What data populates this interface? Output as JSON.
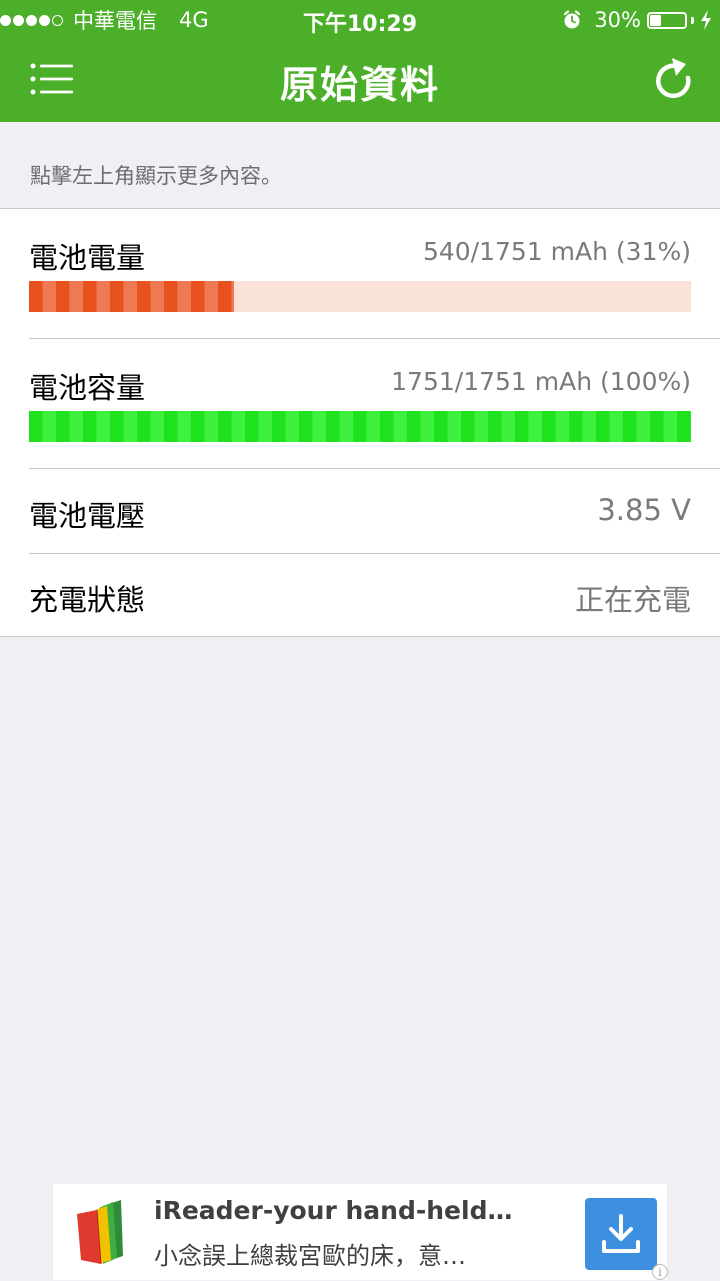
{
  "status_bar": {
    "carrier": "中華電信",
    "network": "4G",
    "time": "下午10:29",
    "battery_percent_text": "30%",
    "battery_level": 0.3,
    "icons": [
      "signal-dots-icon",
      "alarm-icon",
      "battery-icon",
      "charging-bolt-icon"
    ]
  },
  "nav": {
    "title": "原始資料",
    "left_icon": "menu-icon",
    "right_icon": "refresh-icon"
  },
  "hint": "點擊左上角顯示更多內容。",
  "rows": [
    {
      "label": "電池電量",
      "value": "540/1751 mAh (31%)",
      "fill": 0.31,
      "color": "#e8521f"
    },
    {
      "label": "電池容量",
      "value": "1751/1751 mAh (100%)",
      "fill": 1.0,
      "color": "#1de21d"
    },
    {
      "label": "電池電壓",
      "value": "3.85 V"
    },
    {
      "label": "充電狀態",
      "value": "正在充電"
    }
  ],
  "ad": {
    "title": "iReader-your hand-held…",
    "subtitle": "小念誤上總裁宮歐的床，意…",
    "logo_icon": "ireader-book-icon",
    "action_icon": "download-icon",
    "info_icon": "info-icon",
    "info_symbol": "i"
  },
  "colors": {
    "header": "#4caf2a",
    "background": "#efeff4",
    "download_button": "#3d8fe0"
  }
}
